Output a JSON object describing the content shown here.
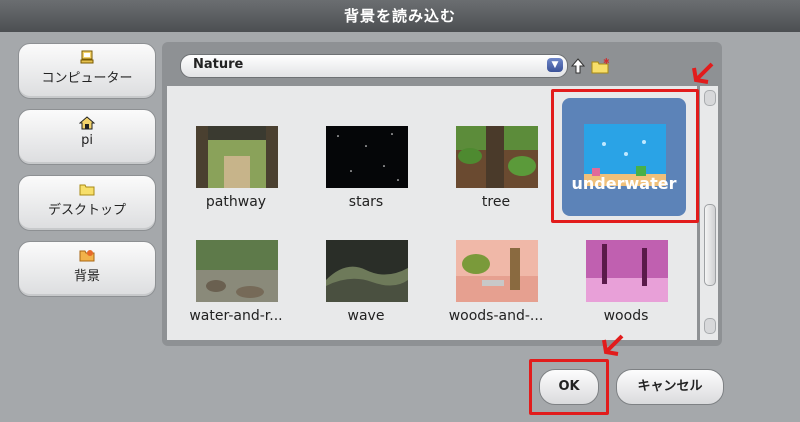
{
  "dialog": {
    "title": "背景を読み込む"
  },
  "sidebar": {
    "items": [
      {
        "label": "コンピューター",
        "icon": "computer-icon"
      },
      {
        "label": "pi",
        "icon": "home-icon"
      },
      {
        "label": "デスクトップ",
        "icon": "folder-icon"
      },
      {
        "label": "背景",
        "icon": "backgrounds-folder-icon"
      }
    ]
  },
  "location": {
    "selected": "Nature"
  },
  "files": [
    {
      "name": "pathway"
    },
    {
      "name": "stars"
    },
    {
      "name": "tree"
    },
    {
      "name": "underwater"
    },
    {
      "name": "water-and-r..."
    },
    {
      "name": "wave"
    },
    {
      "name": "woods-and-..."
    },
    {
      "name": "woods"
    }
  ],
  "buttons": {
    "ok": "OK",
    "cancel": "キャンセル"
  },
  "colors": {
    "highlight": "#e21c1c",
    "selection": "#5c83b8"
  }
}
